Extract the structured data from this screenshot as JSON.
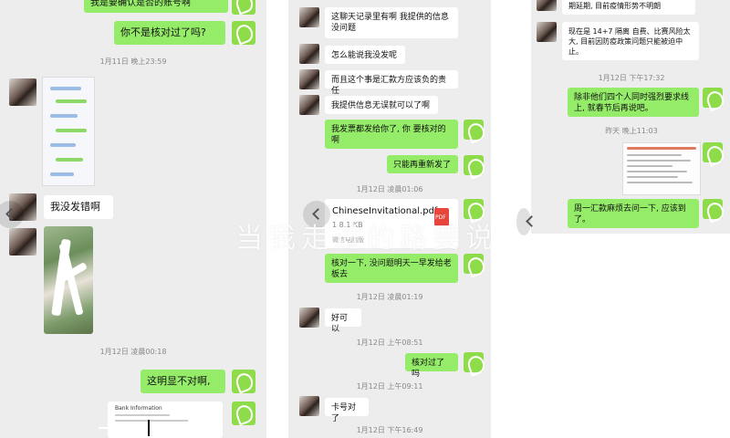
{
  "panel1": {
    "msgs": [
      {
        "text": "我是要确认是否的账号啊"
      },
      {
        "text": "你不是核对过了吗?"
      },
      {
        "text": "我没发错啊"
      },
      {
        "text": "这明显不对啊,"
      }
    ],
    "times": [
      "1月11日 晚上23:59",
      "1月12日 凌晨00:18"
    ],
    "card_title": "Bank Information"
  },
  "panel2": {
    "msgs": [
      {
        "text": "这聊天记录里有啊 我提供的信息没问题"
      },
      {
        "text": "怎么能说我没发呢"
      },
      {
        "text": "而且这个事是汇款方应该负的责任"
      },
      {
        "text": "我提供信息无误就可以了啊"
      },
      {
        "text": "我发票都发给你了, 你 要核对的啊"
      },
      {
        "text": "只能再重新发了"
      },
      {
        "text": "核对一下, 没问题明天一早发给老板去"
      },
      {
        "text": "好可以"
      },
      {
        "text": "核对过了吗"
      },
      {
        "text": "卡号对了"
      }
    ],
    "times": [
      "1月12日 凌晨01:06",
      "1月12日 凌晨01:19",
      "1月12日 上午08:51",
      "1月12日 上午09:11",
      "1月12日 下午16:49"
    ],
    "file": {
      "name": "ChineseInvitational.pdf",
      "size": "1.8.1 KB",
      "icon_label": "PDF",
      "source": "微信电脑版"
    }
  },
  "panel3": {
    "msgs": [
      {
        "text": "期延期, 目前疫情形势不明朗"
      },
      {
        "text": "现在是 14+7 隔离 自费、比赛风险太大, 目前因防疫政策问题只能被迫中止。"
      },
      {
        "text": "除非他们四个人同时强烈要求线上, 就春节后再说吧。"
      },
      {
        "text": "周一汇款麻烦去问一下, 应该到了。"
      }
    ],
    "times": [
      "1月12日 下午17:32",
      "昨天 晚上11:03"
    ]
  },
  "watermark": "当我走过的路要说",
  "colors": {
    "out_bubble": "#95ec69",
    "in_bubble": "#ffffff",
    "chat_bg": "#ededed",
    "app_icon": "#8edc4a"
  },
  "icons": {
    "avatar_out": "wechat-green-icon",
    "nav": "chevron-left-icon",
    "file": "pdf-icon"
  }
}
